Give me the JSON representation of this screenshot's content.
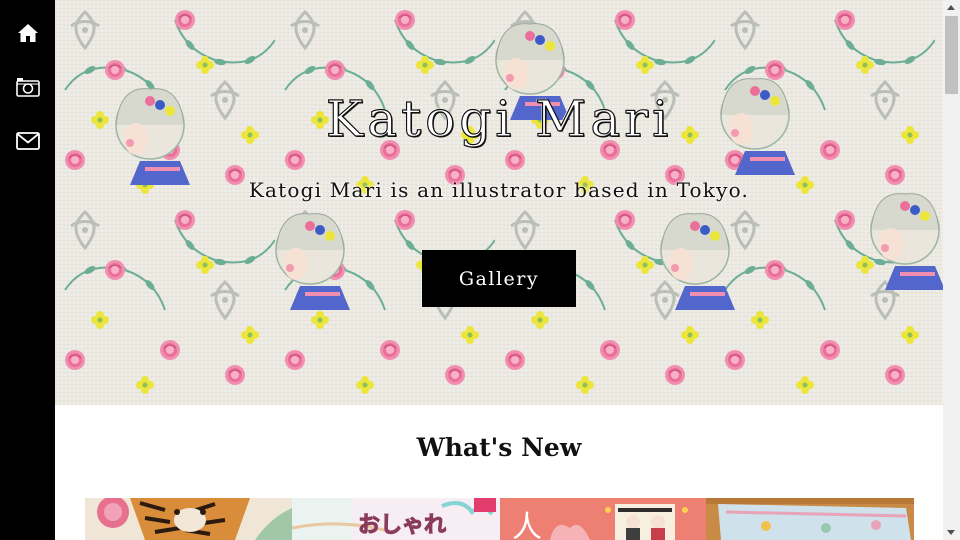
{
  "sidebar": {
    "items": [
      {
        "name": "home",
        "icon": "home-icon"
      },
      {
        "name": "gallery",
        "icon": "camera-icon"
      },
      {
        "name": "contact",
        "icon": "envelope-icon"
      }
    ]
  },
  "hero": {
    "title": "Katogi Mari",
    "subtitle": "Katogi Mari is an illustrator based in Tokyo.",
    "button_label": "Gallery"
  },
  "news": {
    "heading": "What's New",
    "thumbnails": [
      {
        "name": "tiger-illustration",
        "text": ""
      },
      {
        "name": "oshare-book-cover",
        "text": "おしゃれ"
      },
      {
        "name": "hina-dolls-illustration",
        "text": "人"
      },
      {
        "name": "fabric-photo",
        "text": ""
      }
    ]
  },
  "colors": {
    "sidebar": "#000000",
    "button": "#000000",
    "rose": "#ef6b9a",
    "leaf": "#5fae8e",
    "yellow": "#e8e23a"
  }
}
